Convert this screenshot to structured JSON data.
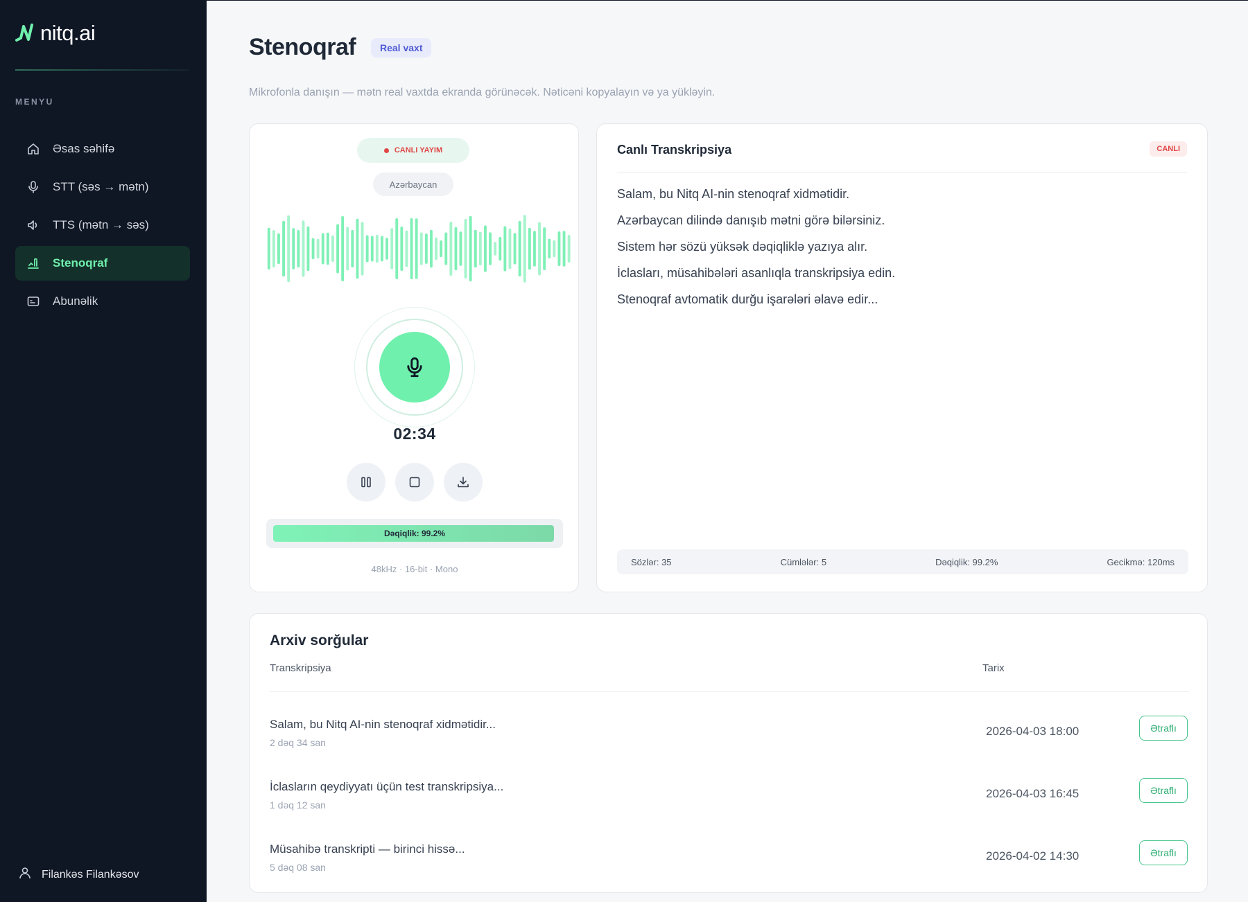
{
  "app": {
    "brand": "nitq.ai",
    "menu_title": "MENYU",
    "accent": "#6ff0ad",
    "sidebar_bg": "#0f1624",
    "nav": [
      {
        "label": "Əsas səhifə",
        "icon": "home-icon"
      },
      {
        "label": "STT (səs → mətn)",
        "icon": "microphone-icon"
      },
      {
        "label": "TTS (mətn → səs)",
        "icon": "speaker-icon"
      },
      {
        "label": "Stenoqraf",
        "icon": "stenograph-icon",
        "active": true
      },
      {
        "label": "Abunəlik",
        "icon": "subscription-icon"
      }
    ],
    "user": {
      "name": "Filankəs Filankəsov",
      "icon": "user-icon"
    }
  },
  "page": {
    "title": "Stenoqraf",
    "badge": "Real vaxt",
    "subtitle": "Mikrofonla danışın — mətn real vaxtda ekranda görünəcək. Nəticəni kopyalayın və ya yükləyin."
  },
  "recorder": {
    "live_label": "CANLI YAYIM",
    "language": "Azərbaycan",
    "timer": "02:34",
    "controls": [
      {
        "name": "pause-button",
        "icon": "pause-icon"
      },
      {
        "name": "stop-button",
        "icon": "stop-icon"
      },
      {
        "name": "download-button",
        "icon": "download-icon"
      }
    ],
    "accuracy_label": "Dəqiqlik: 99.2%",
    "accuracy_value": 99.2,
    "audio_meta": "48kHz · 16-bit · Mono"
  },
  "transcript": {
    "title": "Canlı Transkripsiya",
    "badge": "CANLI",
    "lines": [
      "Salam, bu Nitq AI-nin stenoqraf xidmətidir.",
      "Azərbaycan dilində danışıb mətni görə bilərsiniz.",
      "Sistem hər sözü yüksək dəqiqliklə yazıya alır.",
      "İclasları, müsahibələri asanlıqla transkripsiya edin.",
      "Stenoqraf avtomatik durğu işarələri əlavə edir..."
    ],
    "stats": {
      "words": "Sözlər: 35",
      "sentences": "Cümlələr: 5",
      "accuracy": "Dəqiqlik: 99.2%",
      "latency": "Gecikmə: 120ms"
    }
  },
  "archive": {
    "title": "Arxiv sorğular",
    "col_transcript": "Transkripsiya",
    "col_date": "Tarix",
    "rows": [
      {
        "name": "Salam, bu Nitq AI-nin stenoqraf xidmətidir...",
        "duration": "2 dəq 34 san",
        "date": "2026-04-03 18:00",
        "action": "Ətraflı"
      },
      {
        "name": "İclasların qeydiyyatı üçün test transkripsiya...",
        "duration": "1 dəq 12 san",
        "date": "2026-04-03 16:45",
        "action": "Ətraflı"
      },
      {
        "name": "Müsahibə transkripti — birinci hissə...",
        "duration": "5 dəq 08 san",
        "date": "2026-04-02 14:30",
        "action": "Ətraflı"
      }
    ]
  }
}
